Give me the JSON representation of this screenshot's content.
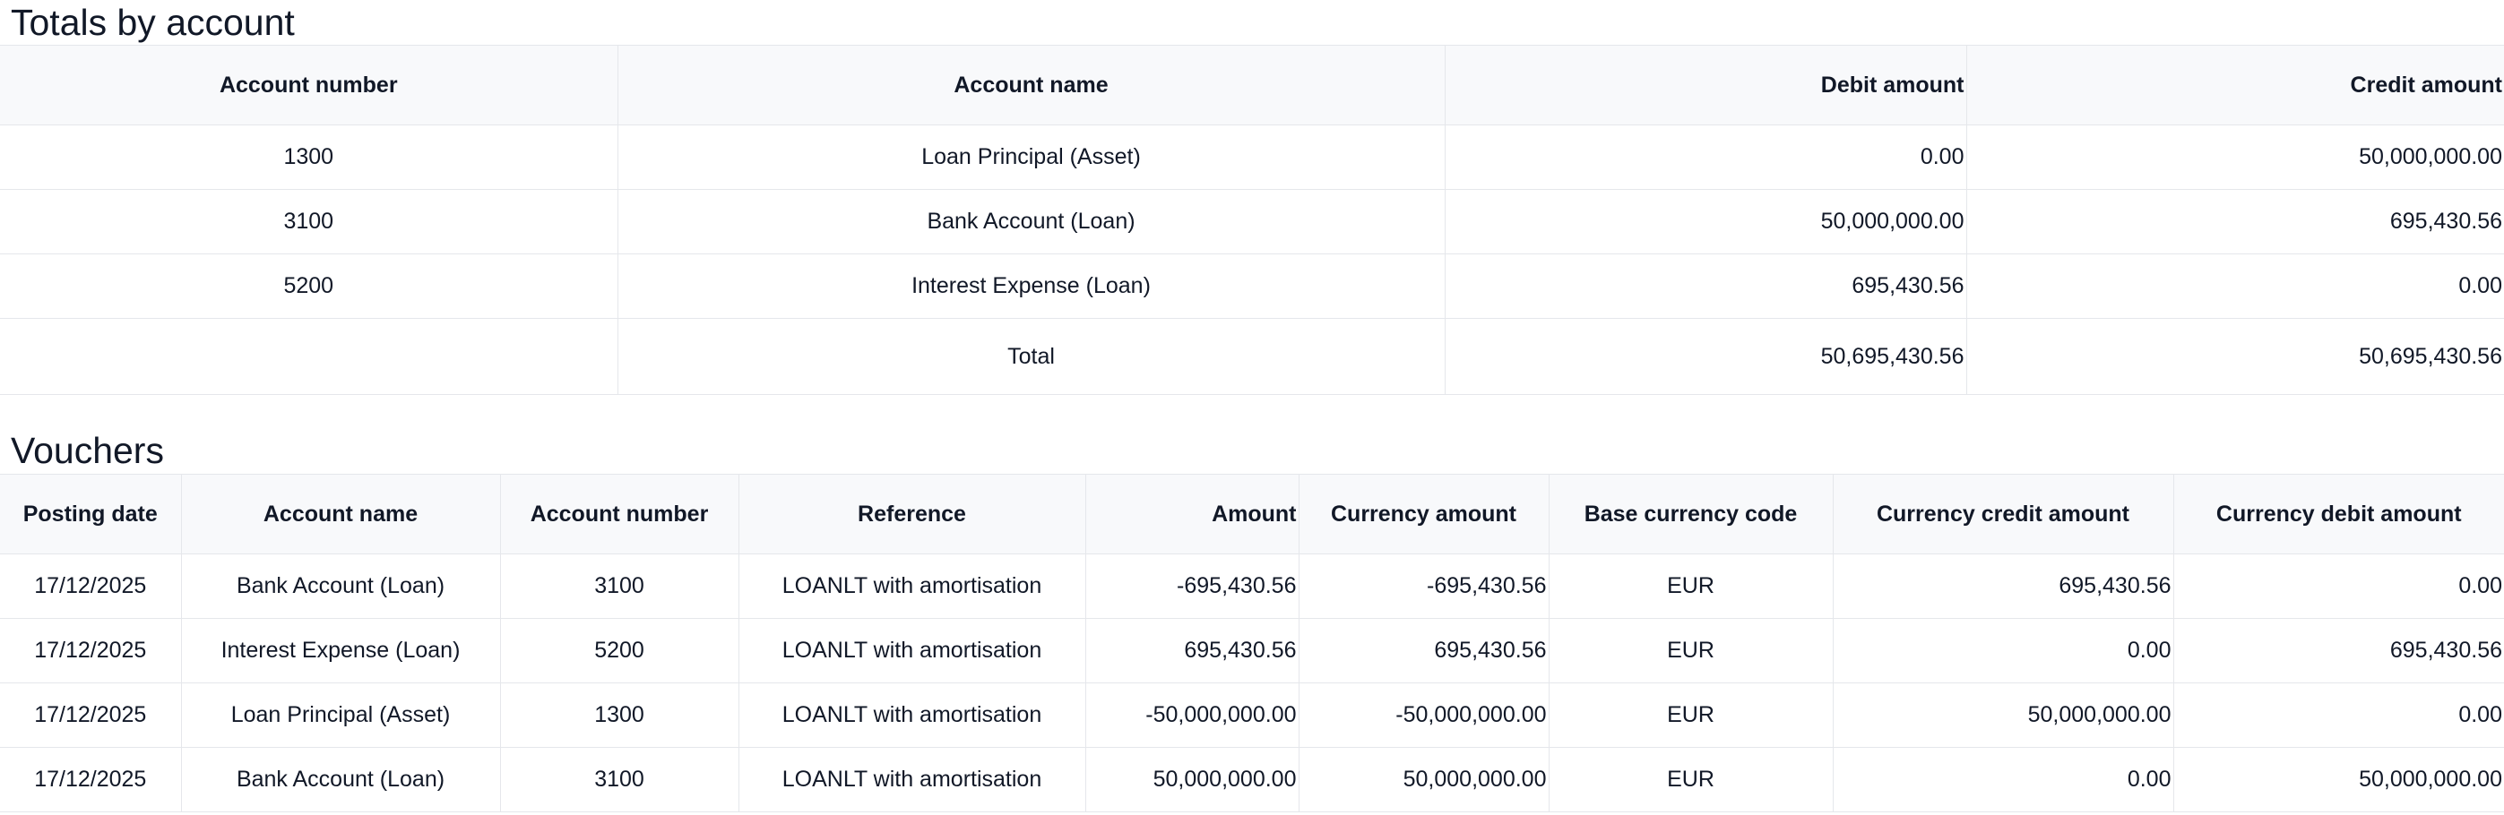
{
  "totals": {
    "title": "Totals by account",
    "headers": {
      "account_number": "Account number",
      "account_name": "Account name",
      "debit_amount": "Debit amount",
      "credit_amount": "Credit amount"
    },
    "rows": [
      {
        "account_number": "1300",
        "account_name": "Loan Principal (Asset)",
        "debit": "0.00",
        "credit": "50,000,000.00"
      },
      {
        "account_number": "3100",
        "account_name": "Bank Account (Loan)",
        "debit": "50,000,000.00",
        "credit": "695,430.56"
      },
      {
        "account_number": "5200",
        "account_name": "Interest Expense (Loan)",
        "debit": "695,430.56",
        "credit": "0.00"
      }
    ],
    "total_row": {
      "label": "Total",
      "debit": "50,695,430.56",
      "credit": "50,695,430.56"
    }
  },
  "vouchers": {
    "title": "Vouchers",
    "headers": {
      "posting_date": "Posting date",
      "account_name": "Account name",
      "account_number": "Account number",
      "reference": "Reference",
      "amount": "Amount",
      "currency_amount": "Currency amount",
      "base_currency_code": "Base currency code",
      "currency_credit_amount": "Currency credit amount",
      "currency_debit_amount": "Currency debit amount"
    },
    "rows": [
      {
        "posting_date": "17/12/2025",
        "account_name": "Bank Account (Loan)",
        "account_number": "3100",
        "reference": "LOANLT with amortisation",
        "amount": "-695,430.56",
        "currency_amount": "-695,430.56",
        "base_currency_code": "EUR",
        "currency_credit_amount": "695,430.56",
        "currency_debit_amount": "0.00"
      },
      {
        "posting_date": "17/12/2025",
        "account_name": "Interest Expense (Loan)",
        "account_number": "5200",
        "reference": "LOANLT with amortisation",
        "amount": "695,430.56",
        "currency_amount": "695,430.56",
        "base_currency_code": "EUR",
        "currency_credit_amount": "0.00",
        "currency_debit_amount": "695,430.56"
      },
      {
        "posting_date": "17/12/2025",
        "account_name": "Loan Principal (Asset)",
        "account_number": "1300",
        "reference": "LOANLT with amortisation",
        "amount": "-50,000,000.00",
        "currency_amount": "-50,000,000.00",
        "base_currency_code": "EUR",
        "currency_credit_amount": "50,000,000.00",
        "currency_debit_amount": "0.00"
      },
      {
        "posting_date": "17/12/2025",
        "account_name": "Bank Account (Loan)",
        "account_number": "3100",
        "reference": "LOANLT with amortisation",
        "amount": "50,000,000.00",
        "currency_amount": "50,000,000.00",
        "base_currency_code": "EUR",
        "currency_credit_amount": "0.00",
        "currency_debit_amount": "50,000,000.00"
      }
    ]
  }
}
